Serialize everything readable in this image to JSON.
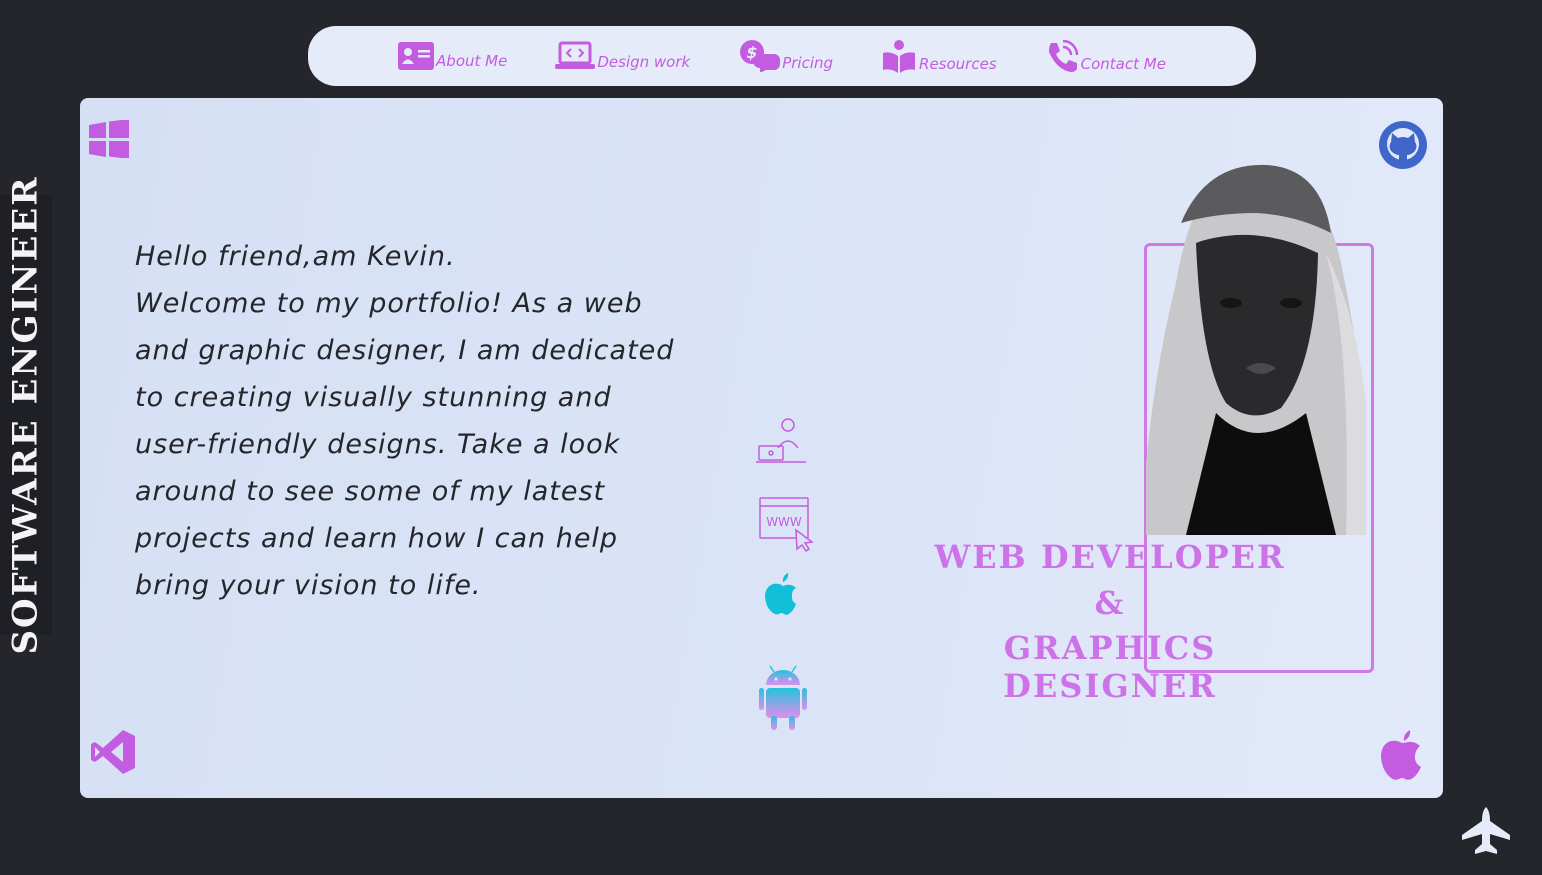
{
  "side_title": "SOFTWARE  ENGINEER",
  "nav": {
    "items": [
      {
        "label": "About Me",
        "icon": "id-card-icon"
      },
      {
        "label": "Design work",
        "icon": "laptop-code-icon"
      },
      {
        "label": "Pricing",
        "icon": "pricing-chat-icon"
      },
      {
        "label": "Resources",
        "icon": "reader-book-icon"
      },
      {
        "label": "Contact Me",
        "icon": "phone-call-icon"
      }
    ]
  },
  "intro": {
    "lines": [
      "Hello friend,am Kevin.",
      "Welcome to my portfolio! As a web",
      "and graphic designer, I am dedicated",
      "to creating visually stunning and",
      "user-friendly designs. Take a look",
      "around to see some of my latest",
      "projects and learn how I can help",
      "bring your vision to life."
    ]
  },
  "timeline": {
    "icons": [
      "developer-desk-icon",
      "www-browser-icon",
      "apple-icon",
      "android-icon"
    ],
    "www_text": "WWW"
  },
  "role": {
    "line1": "WEB DEVELOPER",
    "line2": "&",
    "line3": "GRAPHICS DESIGNER"
  },
  "corners": [
    "windows-icon",
    "github-icon",
    "vscode-icon",
    "apple-icon"
  ],
  "colors": {
    "accent": "#c35ce0",
    "background": "#25262c",
    "card": "#dbe4f7",
    "nav": "#e6ebfa",
    "apple_cyan": "#12bfd9"
  }
}
